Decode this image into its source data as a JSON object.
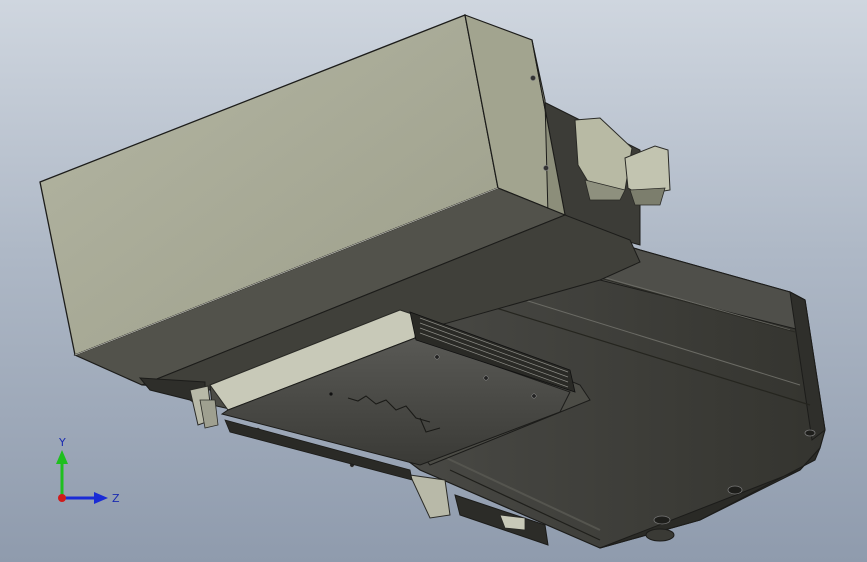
{
  "viewport": {
    "colors": {
      "background_top": "#cfd6df",
      "background_bottom": "#8f9bad",
      "motor_housing": "#a8aa96",
      "dark_body": "#3e3e3a",
      "edge": "#1c1c1a"
    }
  },
  "triad": {
    "y_label": "Y",
    "z_label": "Z",
    "colors": {
      "y": "#1fbf1f",
      "z": "#1a2bd6",
      "x": "#d01a1a"
    }
  }
}
